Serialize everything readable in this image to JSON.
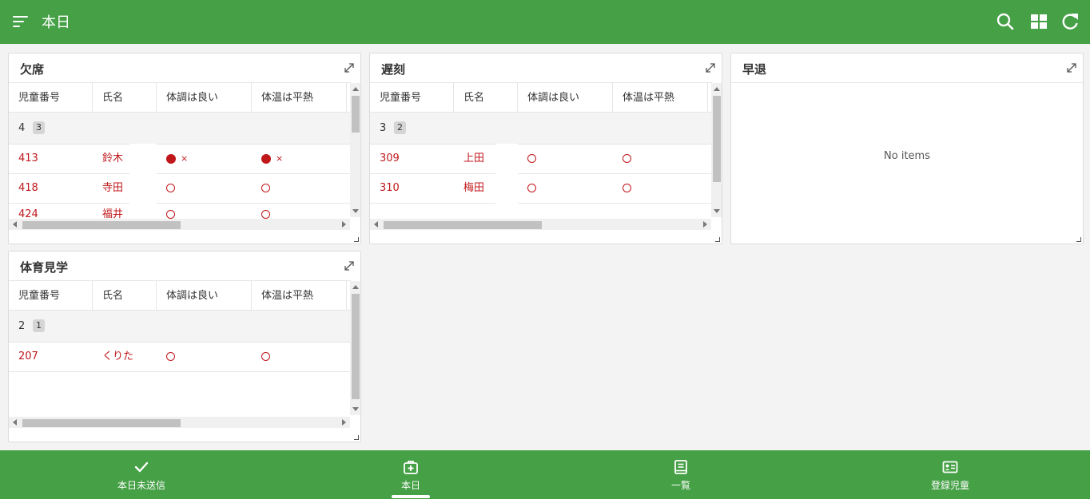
{
  "header": {
    "title": "本日"
  },
  "columns": [
    "児童番号",
    "氏名",
    "体調は良い",
    "体温は平熱"
  ],
  "panels": {
    "absent": {
      "title": "欠席",
      "group": {
        "value": "4",
        "count": "3"
      },
      "rows": [
        {
          "id": "413",
          "name": "鈴木",
          "condition": "●",
          "condition_x": "×",
          "temp": "●",
          "temp_x": "×"
        },
        {
          "id": "418",
          "name": "寺田",
          "condition": "○",
          "temp": "○"
        },
        {
          "id": "424",
          "name": "福井",
          "condition": "○",
          "temp": "○"
        }
      ]
    },
    "late": {
      "title": "遅刻",
      "group": {
        "value": "3",
        "count": "2"
      },
      "rows": [
        {
          "id": "309",
          "name": "上田",
          "condition": "○",
          "temp": "○"
        },
        {
          "id": "310",
          "name": "梅田",
          "condition": "○",
          "temp": "○"
        }
      ]
    },
    "early_leave": {
      "title": "早退",
      "empty_text": "No items"
    },
    "pe_observe": {
      "title": "体育見学",
      "group": {
        "value": "2",
        "count": "1"
      },
      "rows": [
        {
          "id": "207",
          "name": "くりた",
          "condition": "○",
          "temp": "○"
        }
      ]
    }
  },
  "bottom_nav": {
    "items": [
      {
        "label": "本日未送信",
        "icon": "check-icon"
      },
      {
        "label": "本日",
        "icon": "medical-bag-icon",
        "active": true
      },
      {
        "label": "一覧",
        "icon": "book-icon"
      },
      {
        "label": "登録児童",
        "icon": "id-card-icon"
      }
    ]
  },
  "colors": {
    "primary": "#45a046",
    "alert_text": "#c0171b",
    "background": "#f3f3f3"
  }
}
